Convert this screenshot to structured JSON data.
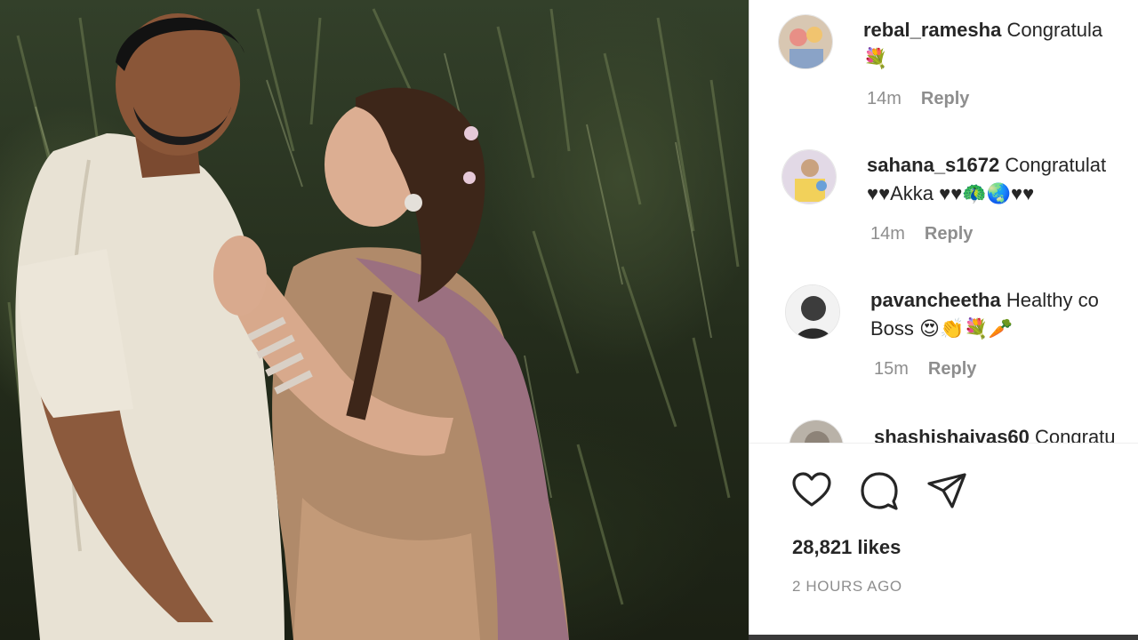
{
  "post": {
    "image_alt": "Couple photo",
    "likes": "28,821 likes",
    "timestamp": "2 HOURS AGO"
  },
  "comments": [
    {
      "username": "rebal_ramesha",
      "text_line1": "Congratula",
      "text_line2": "💐",
      "age": "14m",
      "reply": "Reply"
    },
    {
      "username": "sahana_s1672",
      "text_line1": "Congratulat",
      "text_line2": "♥♥Akka ♥♥🦚🌏♥♥",
      "age": "14m",
      "reply": "Reply"
    },
    {
      "username": "pavancheetha",
      "text_line1": "Healthy co",
      "text_line2": "Boss 😍👏💐🥕",
      "age": "15m",
      "reply": "Reply"
    },
    {
      "username": "shashishaivas60",
      "text_line1": "Congratu",
      "text_line2": "",
      "age": "",
      "reply": ""
    }
  ],
  "actions": {
    "like_icon": "heart-icon",
    "comment_icon": "comment-bubble-icon",
    "share_icon": "paper-plane-icon"
  },
  "colors": {
    "text": "#262626",
    "muted": "#8e8e8e",
    "border": "#dbdbdb"
  }
}
